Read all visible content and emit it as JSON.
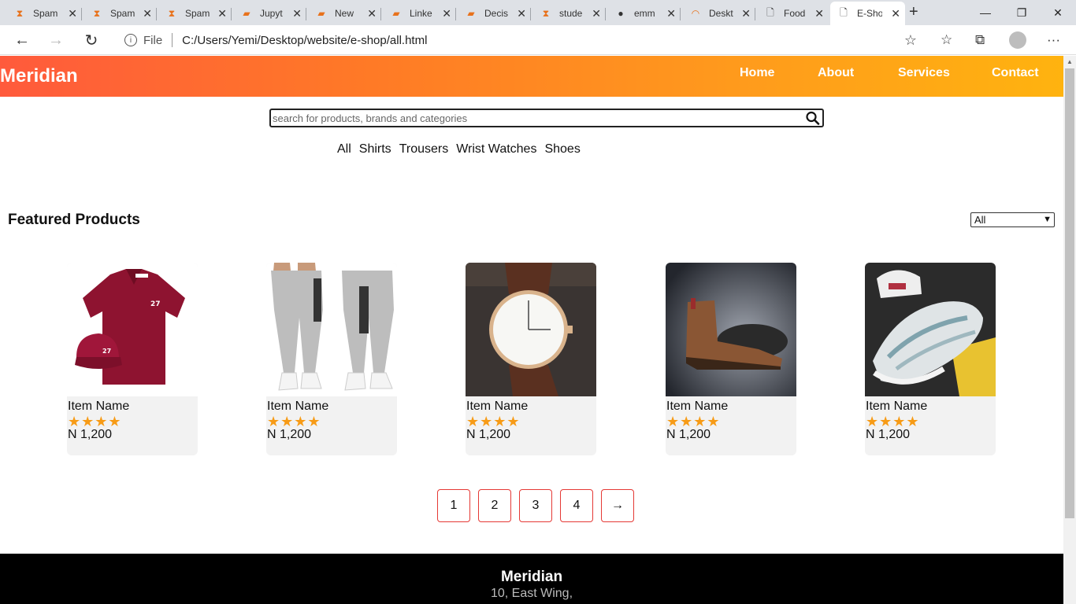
{
  "browser": {
    "tabs": [
      {
        "title": "Spam",
        "icon": "hourglass-icon"
      },
      {
        "title": "Spam",
        "icon": "hourglass-icon"
      },
      {
        "title": "Spam",
        "icon": "hourglass-icon"
      },
      {
        "title": "Jupyt",
        "icon": "book-icon"
      },
      {
        "title": "New",
        "icon": "book-icon"
      },
      {
        "title": "Linke",
        "icon": "book-icon"
      },
      {
        "title": "Decis",
        "icon": "book-icon"
      },
      {
        "title": "stude",
        "icon": "hourglass-icon"
      },
      {
        "title": "emm",
        "icon": "github-icon"
      },
      {
        "title": "Deskt",
        "icon": "loading-icon"
      },
      {
        "title": "Food",
        "icon": "page-icon"
      },
      {
        "title": "E-Sho",
        "icon": "page-icon"
      }
    ],
    "address": {
      "scheme_label": "File",
      "url": "C:/Users/Yemi/Desktop/website/e-shop/all.html"
    }
  },
  "site": {
    "brand": "Meridian",
    "nav": [
      "Home",
      "About",
      "Services",
      "Contact"
    ],
    "search": {
      "placeholder": "search for products, brands and categories"
    },
    "categories": [
      "All",
      "Shirts",
      "Trousers",
      "Wrist Watches",
      "Shoes"
    ],
    "section_title": "Featured Products",
    "filter": {
      "selected": "All"
    },
    "products": [
      {
        "name": "Item Name",
        "rating": 4,
        "price": "N 1,200",
        "image": "red-polo-shirt-and-cap"
      },
      {
        "name": "Item Name",
        "rating": 4,
        "price": "N 1,200",
        "image": "grey-joggers"
      },
      {
        "name": "Item Name",
        "rating": 4,
        "price": "N 1,200",
        "image": "wrist-watch-brown-strap"
      },
      {
        "name": "Item Name",
        "rating": 4,
        "price": "N 1,200",
        "image": "brown-chelsea-boot"
      },
      {
        "name": "Item Name",
        "rating": 4,
        "price": "N 1,200",
        "image": "white-sneaker"
      }
    ],
    "pagination": [
      "1",
      "2",
      "3",
      "4",
      "→"
    ],
    "footer": {
      "brand": "Meridian",
      "address_line1": "10, East Wing,"
    }
  },
  "colors": {
    "header_start": "#ff5a3c",
    "header_end": "#ffb30f",
    "star": "#f79b16",
    "pager_border": "#e53935"
  }
}
